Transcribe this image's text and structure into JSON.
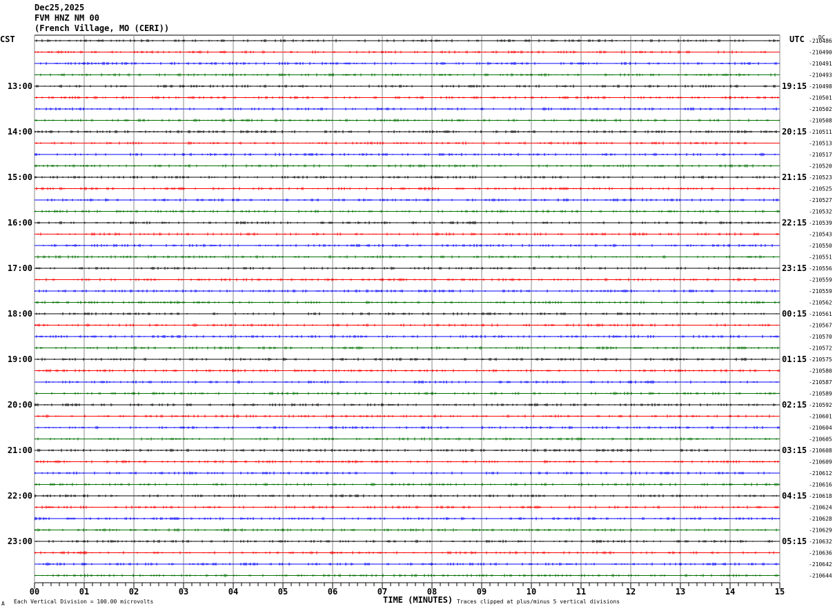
{
  "header": {
    "date": "Dec25,2025",
    "station": "FVM HNZ NM 00",
    "location": "(French Village, MO (CERI))"
  },
  "left_tz": "CST",
  "right_tz": "UTC",
  "dc_label": "DC",
  "footer": {
    "scale_note": "Each Vertical Division =  100.00 microvolts",
    "clip_note": "Traces clipped at plus/minus 5 vertical divisions",
    "corner_mark": "A"
  },
  "chart_data": {
    "type": "line",
    "xlabel": "TIME (MINUTES)",
    "x_ticks": [
      "00",
      "01",
      "02",
      "03",
      "04",
      "05",
      "06",
      "07",
      "08",
      "09",
      "10",
      "11",
      "12",
      "13",
      "14",
      "15"
    ],
    "xlim": [
      0,
      15
    ],
    "trace_colors": [
      "#000000",
      "#ff0000",
      "#0000ff",
      "#007000"
    ],
    "left_hour_labels": [
      "13:00",
      "14:00",
      "15:00",
      "16:00",
      "17:00",
      "18:00",
      "19:00",
      "20:00",
      "21:00",
      "22:00",
      "23:00"
    ],
    "right_hour_labels": [
      "19:15",
      "20:15",
      "21:15",
      "22:15",
      "23:15",
      "00:15",
      "01:15",
      "02:15",
      "03:15",
      "04:15",
      "05:15"
    ],
    "dc_offsets": [
      "-210486",
      "-210490",
      "-210491",
      "-210493",
      "-210498",
      "-210501",
      "-210502",
      "-210508",
      "-210511",
      "-210513",
      "-210517",
      "-210520",
      "-210523",
      "-210525",
      "-210527",
      "-210532",
      "-210539",
      "-210543",
      "-210550",
      "-210551",
      "-210556",
      "-210559",
      "-210559",
      "-210562",
      "-210561",
      "-210567",
      "-210570",
      "-210572",
      "-210575",
      "-210580",
      "-210587",
      "-210589",
      "-210592",
      "-210601",
      "-210604",
      "-210605",
      "-210608",
      "-210609",
      "-210612",
      "-210616",
      "-210618",
      "-210624",
      "-210628",
      "-210629",
      "-210632",
      "-210636",
      "-210642",
      "-210644"
    ]
  }
}
